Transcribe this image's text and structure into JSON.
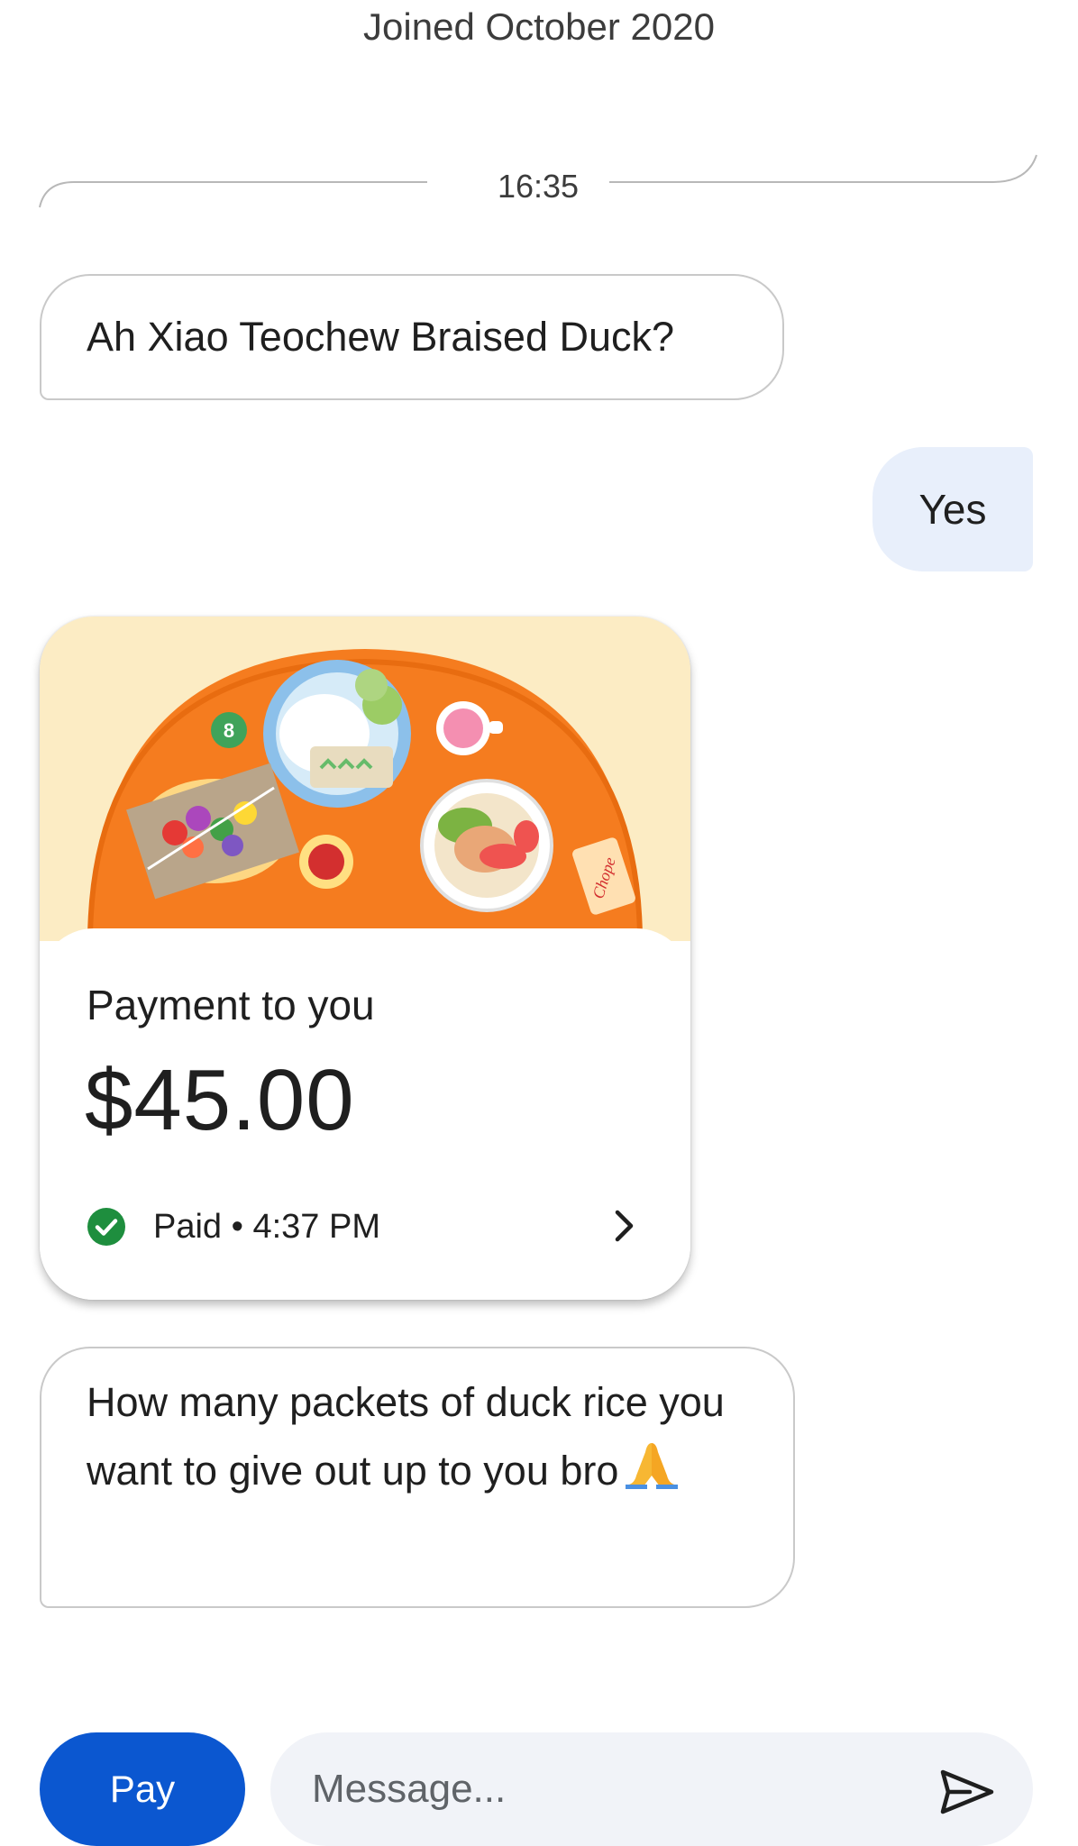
{
  "header": {
    "joined_text": "Joined October 2020"
  },
  "timestamp": {
    "label": "16:35"
  },
  "messages": {
    "incoming_1": "Ah Xiao Teochew Braised Duck?",
    "outgoing_1": "Yes",
    "incoming_2": "How many packets of duck rice you want to give out up to you bro"
  },
  "payment": {
    "title": "Payment to you",
    "amount": "$45.00",
    "status": "Paid • 4:37 PM",
    "status_color": "#1e8e3e",
    "illustration_icon": "food-tray-illustration"
  },
  "composer": {
    "pay_label": "Pay",
    "message_placeholder": "Message...",
    "send_icon": "send-icon",
    "accent": "#0b57d0"
  }
}
